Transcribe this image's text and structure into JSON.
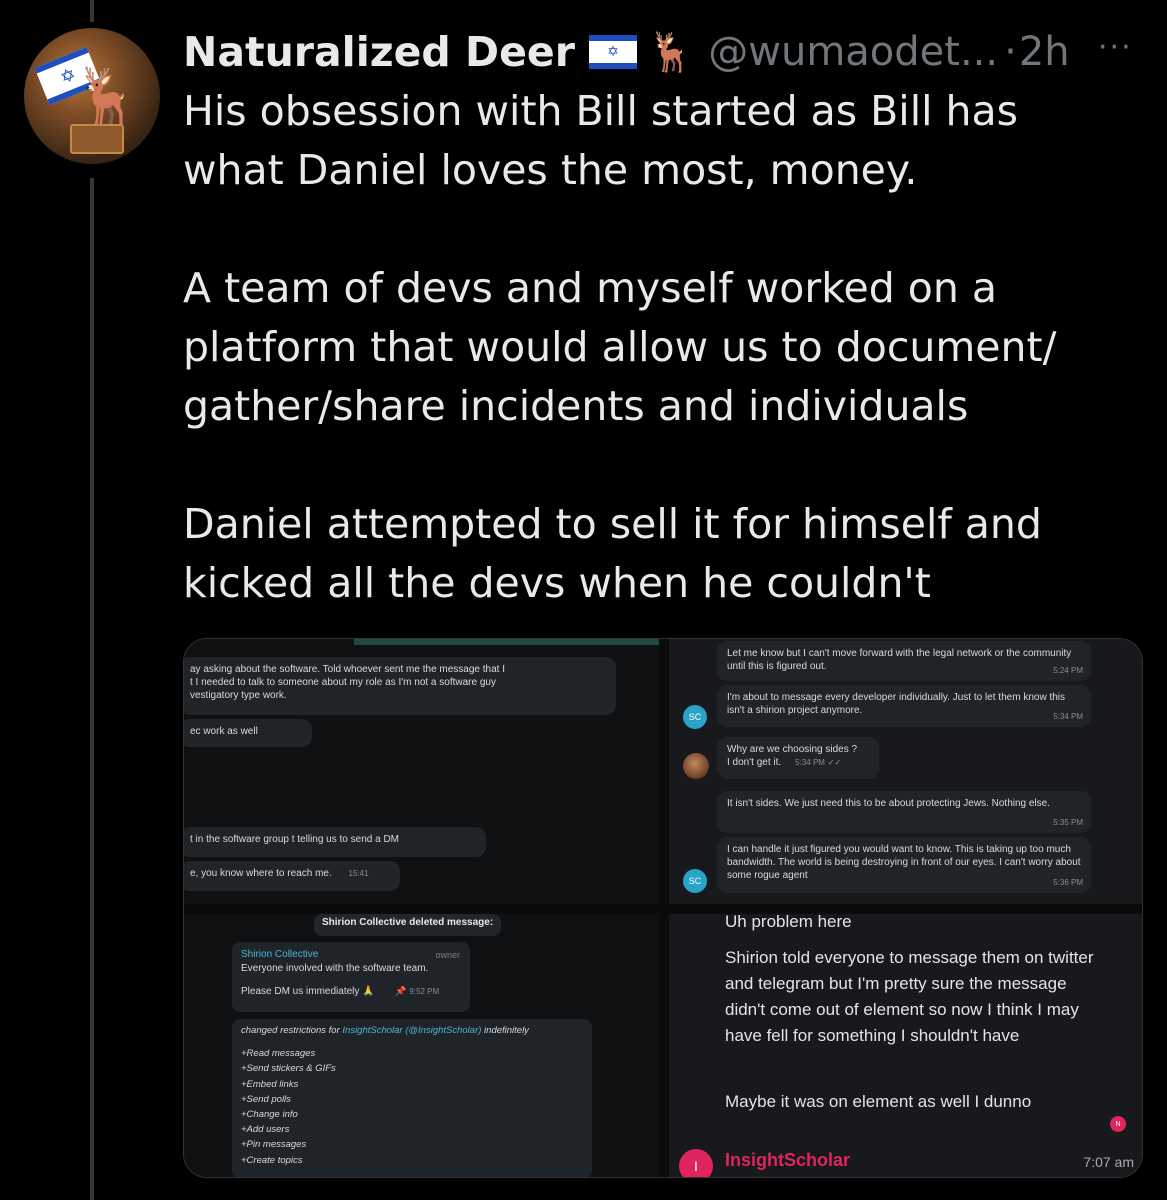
{
  "tweet": {
    "display_name": "Naturalized Deer",
    "handle": "@wumaodet...",
    "separator": "·",
    "time": "2h",
    "more": "···",
    "paragraphs": [
      [
        "His obsession with Bill started as Bill has",
        "what Daniel loves the most, money."
      ],
      [
        "A team of devs and myself worked on a",
        "platform that would allow us to document/",
        "gather/share incidents and individuals"
      ],
      [
        "Daniel attempted to sell it for himself and",
        "kicked all the devs when he couldn't"
      ]
    ]
  },
  "panel1": {
    "msg1": [
      "ay asking about the software. Told whoever sent me the message that I",
      "t I needed to talk to someone about my role as I'm not a software guy",
      "vestigatory type work."
    ],
    "msg2": "ec work as well",
    "msg3": "t in the software group t telling us to send a DM",
    "msg4": "e, you know where to reach me.",
    "msg4_time": "15:41"
  },
  "panel2": {
    "m1": "Let me know but I can't move forward with the legal network or the community until this is figured out.",
    "m1_time": "5:24 PM",
    "m2": "I'm about to message every developer individually. Just to let them know this isn't a shirion project anymore.",
    "m2_time": "5:34 PM",
    "avatar_sc": "SC",
    "m3": [
      "Why are we choosing sides ?",
      "I don't get it."
    ],
    "m3_time": "5:34 PM",
    "m3_check": "✓✓",
    "m4": "It isn't sides. We just need this to be about protecting Jews. Nothing else.",
    "m4_time": "5:35 PM",
    "m5": "I can handle it just figured  you would want to know. This is taking up too much bandwidth. The world is being destroying in front of our eyes. I can't worry about some rogue agent",
    "m5_time": "5:36 PM"
  },
  "panel3": {
    "deleted": "Shirion Collective deleted message:",
    "name": "Shirion Collective",
    "role": "owner",
    "line1": "Everyone involved with the software team.",
    "line2": "Please DM us immediately 🙏",
    "pin": "📌",
    "time": "9:52 PM",
    "restrict_prefix": "changed restrictions for ",
    "restrict_user": "InsightScholar",
    "restrict_handle": "(@InsightScholar)",
    "restrict_suffix": " indefinitely",
    "perms": [
      "+Read messages",
      "+Send stickers & GIFs",
      "+Embed links",
      "+Send polls",
      "+Change info",
      "+Add users",
      "+Pin messages",
      "+Create topics"
    ]
  },
  "panel4": {
    "m1": "Uh problem here",
    "m2": "Shirion told everyone to message them on twitter and telegram but I'm pretty sure the message didn't come out of element so now I think I may have fell for something I shouldn't have",
    "m3": "Maybe it was on element as well I dunno",
    "badge": "N",
    "avatar_letter": "I",
    "name": "InsightScholar",
    "time": "7:07 am"
  }
}
